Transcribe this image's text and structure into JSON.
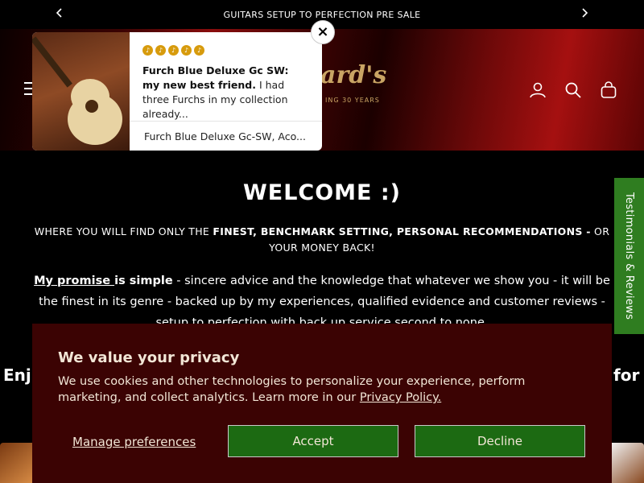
{
  "announcement": {
    "text": "GUITARS SETUP TO PERFECTION PRE SALE",
    "prev_icon": "chevron-left-icon",
    "next_icon": "chevron-right-icon"
  },
  "header": {
    "menu_icon": "hamburger-icon",
    "logo_text": "ard's",
    "logo_sub": "ING 30 YEARS",
    "account_icon": "account-icon",
    "search_icon": "search-icon",
    "cart_icon": "cart-icon"
  },
  "review_popup": {
    "rating": 5,
    "title": "Furch Blue Deluxe Gc SW: my new best friend.",
    "excerpt": "I had three Furchs in my collection already...",
    "product": "Furch Blue Deluxe Gc-SW, Aco...",
    "close_label": "×"
  },
  "main": {
    "welcome": "WELCOME :)",
    "tagline_prefix": "WHERE YOU WILL FIND ONLY THE ",
    "tagline_bold": "FINEST, BENCHMARK SETTING, PERSONAL RECOMMENDATIONS -",
    "tagline_suffix": " OR YOUR MONEY BACK!",
    "promise_link": "My promise ",
    "promise_bold": "is simple",
    "promise_rest": " - sincere advice and the knowledge that whatever we show you - it will be the finest in its genre - backed up by my experiences, qualified evidence and customer reviews - setup to perfection with back up service second to none.",
    "enjoy_left": "Enj",
    "enjoy_right": "for"
  },
  "testimonials_tab": {
    "label": "Testimonials & Reviews"
  },
  "cookie_banner": {
    "title": "We value your privacy",
    "text": "We use cookies and other technologies to personalize your experience, perform marketing, and collect analytics. Learn more in our ",
    "policy_link": "Privacy Policy.",
    "manage_label": "Manage preferences",
    "accept_label": "Accept",
    "decline_label": "Decline"
  },
  "colors": {
    "cookie_bg": "#3b0303",
    "button_green": "#1c6a12",
    "tab_green": "#2f7d20",
    "star_gold": "#d79b0d",
    "logo_gold": "#c9a464"
  }
}
